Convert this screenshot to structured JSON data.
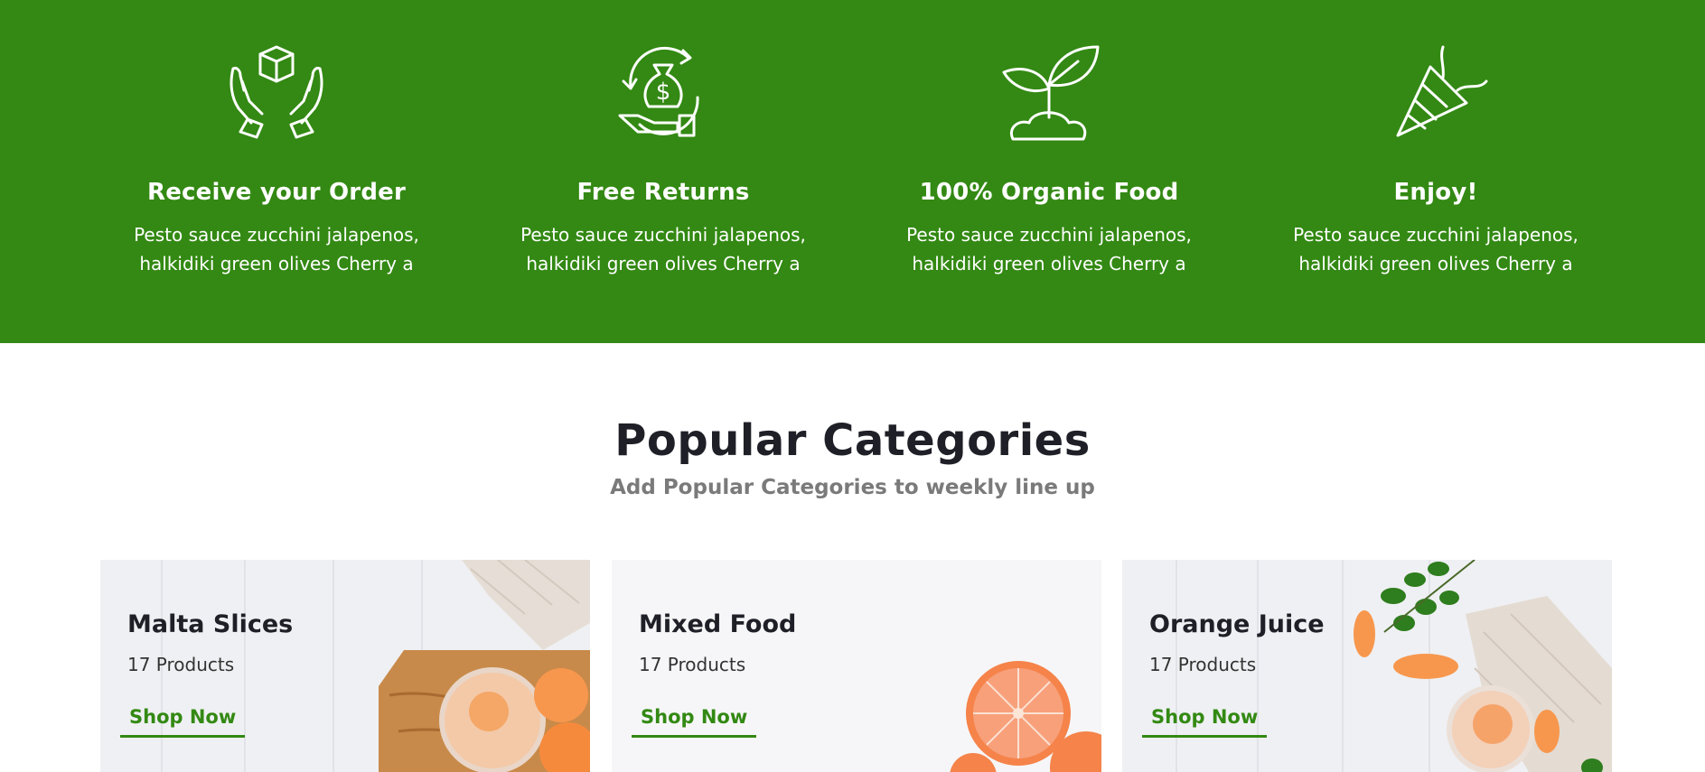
{
  "features": [
    {
      "icon": "hands-box-icon",
      "title": "Receive your Order",
      "text": "Pesto sauce zucchini jalapenos, halkidiki green olives Cherry a"
    },
    {
      "icon": "money-bag-refund-icon",
      "title": "Free Returns",
      "text": "Pesto sauce zucchini jalapenos, halkidiki green olives Cherry a"
    },
    {
      "icon": "sprout-icon",
      "title": "100% Organic Food",
      "text": "Pesto sauce zucchini jalapenos, halkidiki green olives Cherry a"
    },
    {
      "icon": "party-popper-icon",
      "title": "Enjoy!",
      "text": "Pesto sauce zucchini jalapenos, halkidiki green olives Cherry a"
    }
  ],
  "categories": {
    "title": "Popular Categories",
    "subtitle": "Add Popular Categories to weekly line up",
    "cards": [
      {
        "name": "Malta Slices",
        "count": "17 Products",
        "cta": "Shop Now"
      },
      {
        "name": "Mixed Food",
        "count": "17 Products",
        "cta": "Shop Now"
      },
      {
        "name": "Orange Juice",
        "count": "17 Products",
        "cta": "Shop Now"
      }
    ]
  },
  "colors": {
    "brand_green": "#338913",
    "heading": "#1f1f27",
    "subtitle": "#7a7a7a"
  }
}
